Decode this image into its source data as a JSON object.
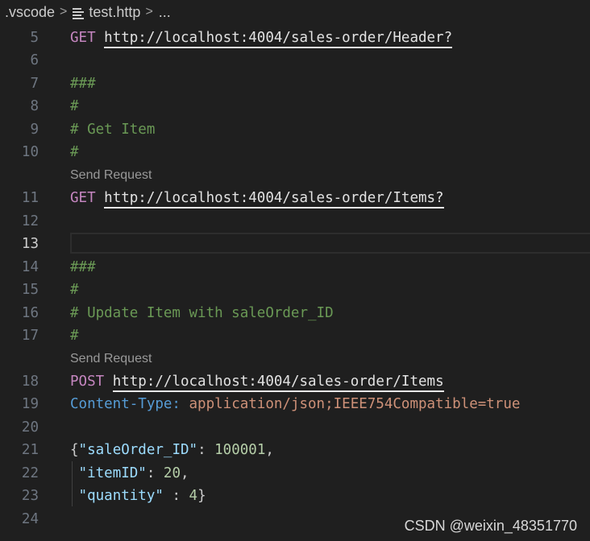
{
  "breadcrumb": {
    "folder": ".vscode",
    "separator": ">",
    "file": "test.http",
    "trailing": "..."
  },
  "editor": {
    "send_request_label": "Send Request",
    "lines": [
      {
        "no": "5",
        "method": "GET",
        "url": "http://localhost:4004/sales-order/Header?"
      },
      {
        "no": "6"
      },
      {
        "no": "7",
        "comment": "###"
      },
      {
        "no": "8",
        "comment": "#"
      },
      {
        "no": "9",
        "comment": "# Get Item"
      },
      {
        "no": "10",
        "comment": "#"
      },
      {
        "no": "11",
        "method": "GET",
        "url": "http://localhost:4004/sales-order/Items?"
      },
      {
        "no": "12"
      },
      {
        "no": "13"
      },
      {
        "no": "14",
        "comment": "###"
      },
      {
        "no": "15",
        "comment": "#"
      },
      {
        "no": "16",
        "comment": "# Update Item with saleOrder_ID"
      },
      {
        "no": "17",
        "comment": "#"
      },
      {
        "no": "18",
        "method": "POST",
        "url": "http://localhost:4004/sales-order/Items"
      },
      {
        "no": "19",
        "header_name": "Content-Type:",
        "header_value": "application/json;IEEE754Compatible=true"
      },
      {
        "no": "20"
      },
      {
        "no": "21",
        "open": "{",
        "key": "\"saleOrder_ID\"",
        "sep": ": ",
        "value": "100001",
        "tail": ","
      },
      {
        "no": "22",
        "indent": " ",
        "key": "\"itemID\"",
        "sep": ": ",
        "value": "20",
        "tail": ","
      },
      {
        "no": "23",
        "indent": " ",
        "key": "\"quantity\"",
        "sep": " : ",
        "value": "4",
        "tail": "}"
      },
      {
        "no": "24"
      }
    ]
  },
  "watermark": "CSDN @weixin_48351770",
  "colors": {
    "background": "#1f1f1f",
    "keyword": "#c586c0",
    "comment": "#6a9955",
    "header_name": "#569cd6",
    "header_value": "#ce9178",
    "json_key": "#9cdcfe",
    "json_number": "#b5cea8"
  }
}
